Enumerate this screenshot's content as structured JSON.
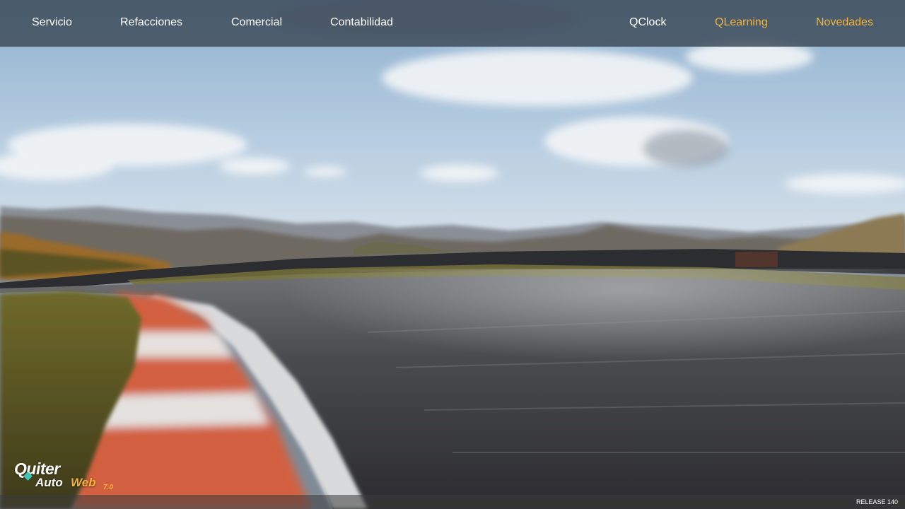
{
  "nav": {
    "left": [
      {
        "label": "Servicio"
      },
      {
        "label": "Refacciones"
      },
      {
        "label": "Comercial"
      },
      {
        "label": "Contabilidad"
      }
    ],
    "right": [
      {
        "label": "QClock"
      },
      {
        "label": "QLearning"
      },
      {
        "label": "Novedades"
      }
    ]
  },
  "logo": {
    "brand": "Quiter",
    "product_part1": "Auto",
    "product_part2": "Web",
    "version": "7.0"
  },
  "footer": {
    "release": "RELEASE 140"
  },
  "colors": {
    "accent": "#f2b33d",
    "nav_text": "#ffffff",
    "topbar_bg": "#3a4856",
    "logo_diamond": "#3fc6b8"
  }
}
